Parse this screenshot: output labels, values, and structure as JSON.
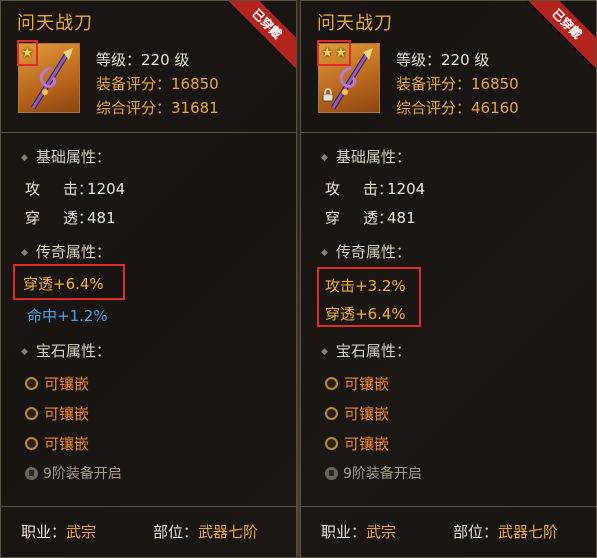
{
  "panels": [
    {
      "title": "问天战刀",
      "equipped_badge": "已穿戴",
      "stars": 1,
      "locked": false,
      "level_line": "等级：220 级",
      "score_line": "装备评分：16850",
      "total_line": "综合评分：31681",
      "basic_title": "基础属性：",
      "basic_attrs": [
        {
          "k1": "攻",
          "k2": "击：",
          "value": "1204"
        },
        {
          "k1": "穿",
          "k2": "透：",
          "value": "481"
        }
      ],
      "legend_title": "传奇属性：",
      "legend_attrs": [
        {
          "label": "穿透+6.4%",
          "color": "#f3b12a"
        },
        {
          "label": "命中+1.2%",
          "color": "#4aa2e6"
        }
      ],
      "gem_title": "宝石属性：",
      "gems": [
        "可镶嵌",
        "可镶嵌",
        "可镶嵌"
      ],
      "unlock_text": "9阶装备开启",
      "job_label": "职业：",
      "job_value": "武宗",
      "slot_label": "部位：",
      "slot_value": "武器七阶"
    },
    {
      "title": "问天战刀",
      "equipped_badge": "已穿戴",
      "stars": 2,
      "locked": true,
      "level_line": "等级：220 级",
      "score_line": "装备评分：16850",
      "total_line": "综合评分：46160",
      "basic_title": "基础属性：",
      "basic_attrs": [
        {
          "k1": "攻",
          "k2": "击：",
          "value": "1204"
        },
        {
          "k1": "穿",
          "k2": "透：",
          "value": "481"
        }
      ],
      "legend_title": "传奇属性：",
      "legend_attrs": [
        {
          "label": "攻击+3.2%",
          "color": "#f3b12a"
        },
        {
          "label": "穿透+6.4%",
          "color": "#f3b12a"
        }
      ],
      "gem_title": "宝石属性：",
      "gems": [
        "可镶嵌",
        "可镶嵌",
        "可镶嵌"
      ],
      "unlock_text": "9阶装备开启",
      "job_label": "职业：",
      "job_value": "武宗",
      "slot_label": "部位：",
      "slot_value": "武器七阶"
    }
  ]
}
